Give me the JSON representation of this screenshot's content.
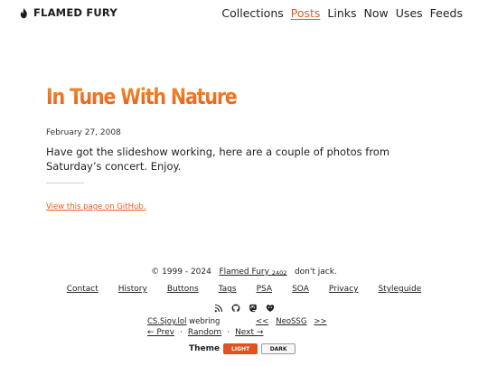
{
  "header": {
    "brand": "FLAMED FURY",
    "nav": [
      "Collections",
      "Posts",
      "Links",
      "Now",
      "Uses",
      "Feeds"
    ],
    "active_nav": "Posts"
  },
  "post": {
    "title": "In Tune With Nature",
    "date": "February 27, 2008",
    "body": "Have got the slideshow working, here are a couple of photos from Saturday’s concert. Enjoy.",
    "github_link": "View this page on GitHub",
    "github_trailing": "."
  },
  "footer": {
    "copyright_prefix": "© 1999 - 2024",
    "site_link": "Flamed Fury",
    "site_number": "2402",
    "tagline": "don't jack.",
    "links": [
      "Contact",
      "History",
      "Buttons",
      "Tags",
      "PSA",
      "SOA",
      "Privacy",
      "Styleguide"
    ],
    "social_icons": [
      "rss-icon",
      "github-icon",
      "mastodon-icon",
      "heart-icon"
    ],
    "webring": {
      "site": "CS.Sjoy.lol",
      "label": "webring",
      "prev": "← Prev",
      "random": "Random",
      "next": "Next →",
      "sep": "·",
      "neossg_prev": "<<",
      "neossg": "NeoSSG",
      "neossg_next": ">>"
    },
    "theme": {
      "label": "Theme",
      "light": "LIGHT",
      "dark": "DARK",
      "selected": "LIGHT"
    }
  },
  "colors": {
    "accent": "#e35e25",
    "title_gradient_top": "#f39a2c",
    "title_gradient_bottom": "#e3511f",
    "text": "#222222",
    "background": "#ffffff"
  }
}
